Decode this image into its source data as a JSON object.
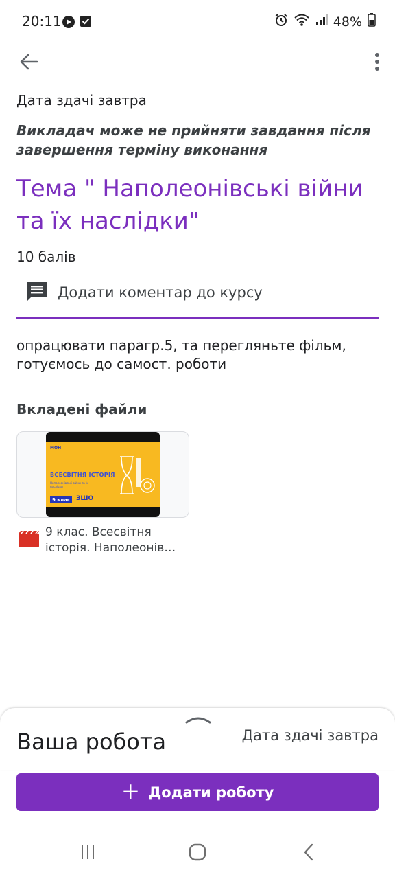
{
  "status_bar": {
    "time": "20:11",
    "battery": "48%",
    "icons": [
      "media-icon",
      "check-square-icon",
      "alarm-icon",
      "wifi-icon",
      "signal-icon",
      "battery-icon"
    ]
  },
  "app_bar": {
    "back_icon": "arrow-back-icon",
    "menu_icon": "more-vert-icon"
  },
  "assignment": {
    "due": "Дата здачі завтра",
    "late_warning": "Викладач може не прийняти завдання після завершення терміну виконання",
    "title": "Тема \" Наполеонівські війни та їх наслідки\"",
    "points": "10 балів",
    "comment_label": "Додати коментар до курсу",
    "description": "опрацювати парагр.5, та перегляньте фільм, готуємось до самост. роботи"
  },
  "attachments": {
    "heading": "Вкладені файли",
    "items": [
      {
        "name": "9 клас. Всесвітня історія. Наполеонів…",
        "thumbnail": {
          "logo": "МОН",
          "title": "ВСЕСВІТНЯ ІСТОРІЯ",
          "subtitle": "Наполеонівські війни та їх наслідки",
          "grade": "9 клас",
          "brand": "ЗШО"
        }
      }
    ]
  },
  "bottom_sheet": {
    "title": "Ваша робота",
    "due": "Дата здачі завтра",
    "add_button": "Додати роботу"
  },
  "colors": {
    "accent": "#7b2fbe",
    "file_icon": "#d93025",
    "thumbnail_bg": "#f8b921"
  }
}
